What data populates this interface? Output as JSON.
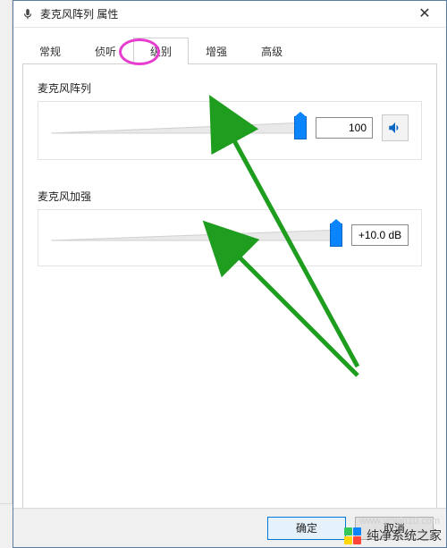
{
  "window": {
    "title": "麦克风阵列 属性",
    "close_glyph": "✕"
  },
  "tabs": {
    "items": [
      {
        "label": "常规"
      },
      {
        "label": "侦听"
      },
      {
        "label": "级别",
        "active": true
      },
      {
        "label": "增强"
      },
      {
        "label": "高级"
      }
    ]
  },
  "levels": {
    "mic_array": {
      "label": "麦克风阵列",
      "value": "100",
      "percent": 100
    },
    "mic_boost": {
      "label": "麦克风加强",
      "value": "+10.0 dB",
      "percent": 100
    }
  },
  "buttons": {
    "ok": "确定",
    "cancel": "取消"
  },
  "watermark": {
    "text": "纯净系统之家",
    "url": "www.ycwin10.com"
  },
  "icons": {
    "mic": "mic-icon",
    "speaker": "speaker-icon",
    "close": "close-icon"
  }
}
